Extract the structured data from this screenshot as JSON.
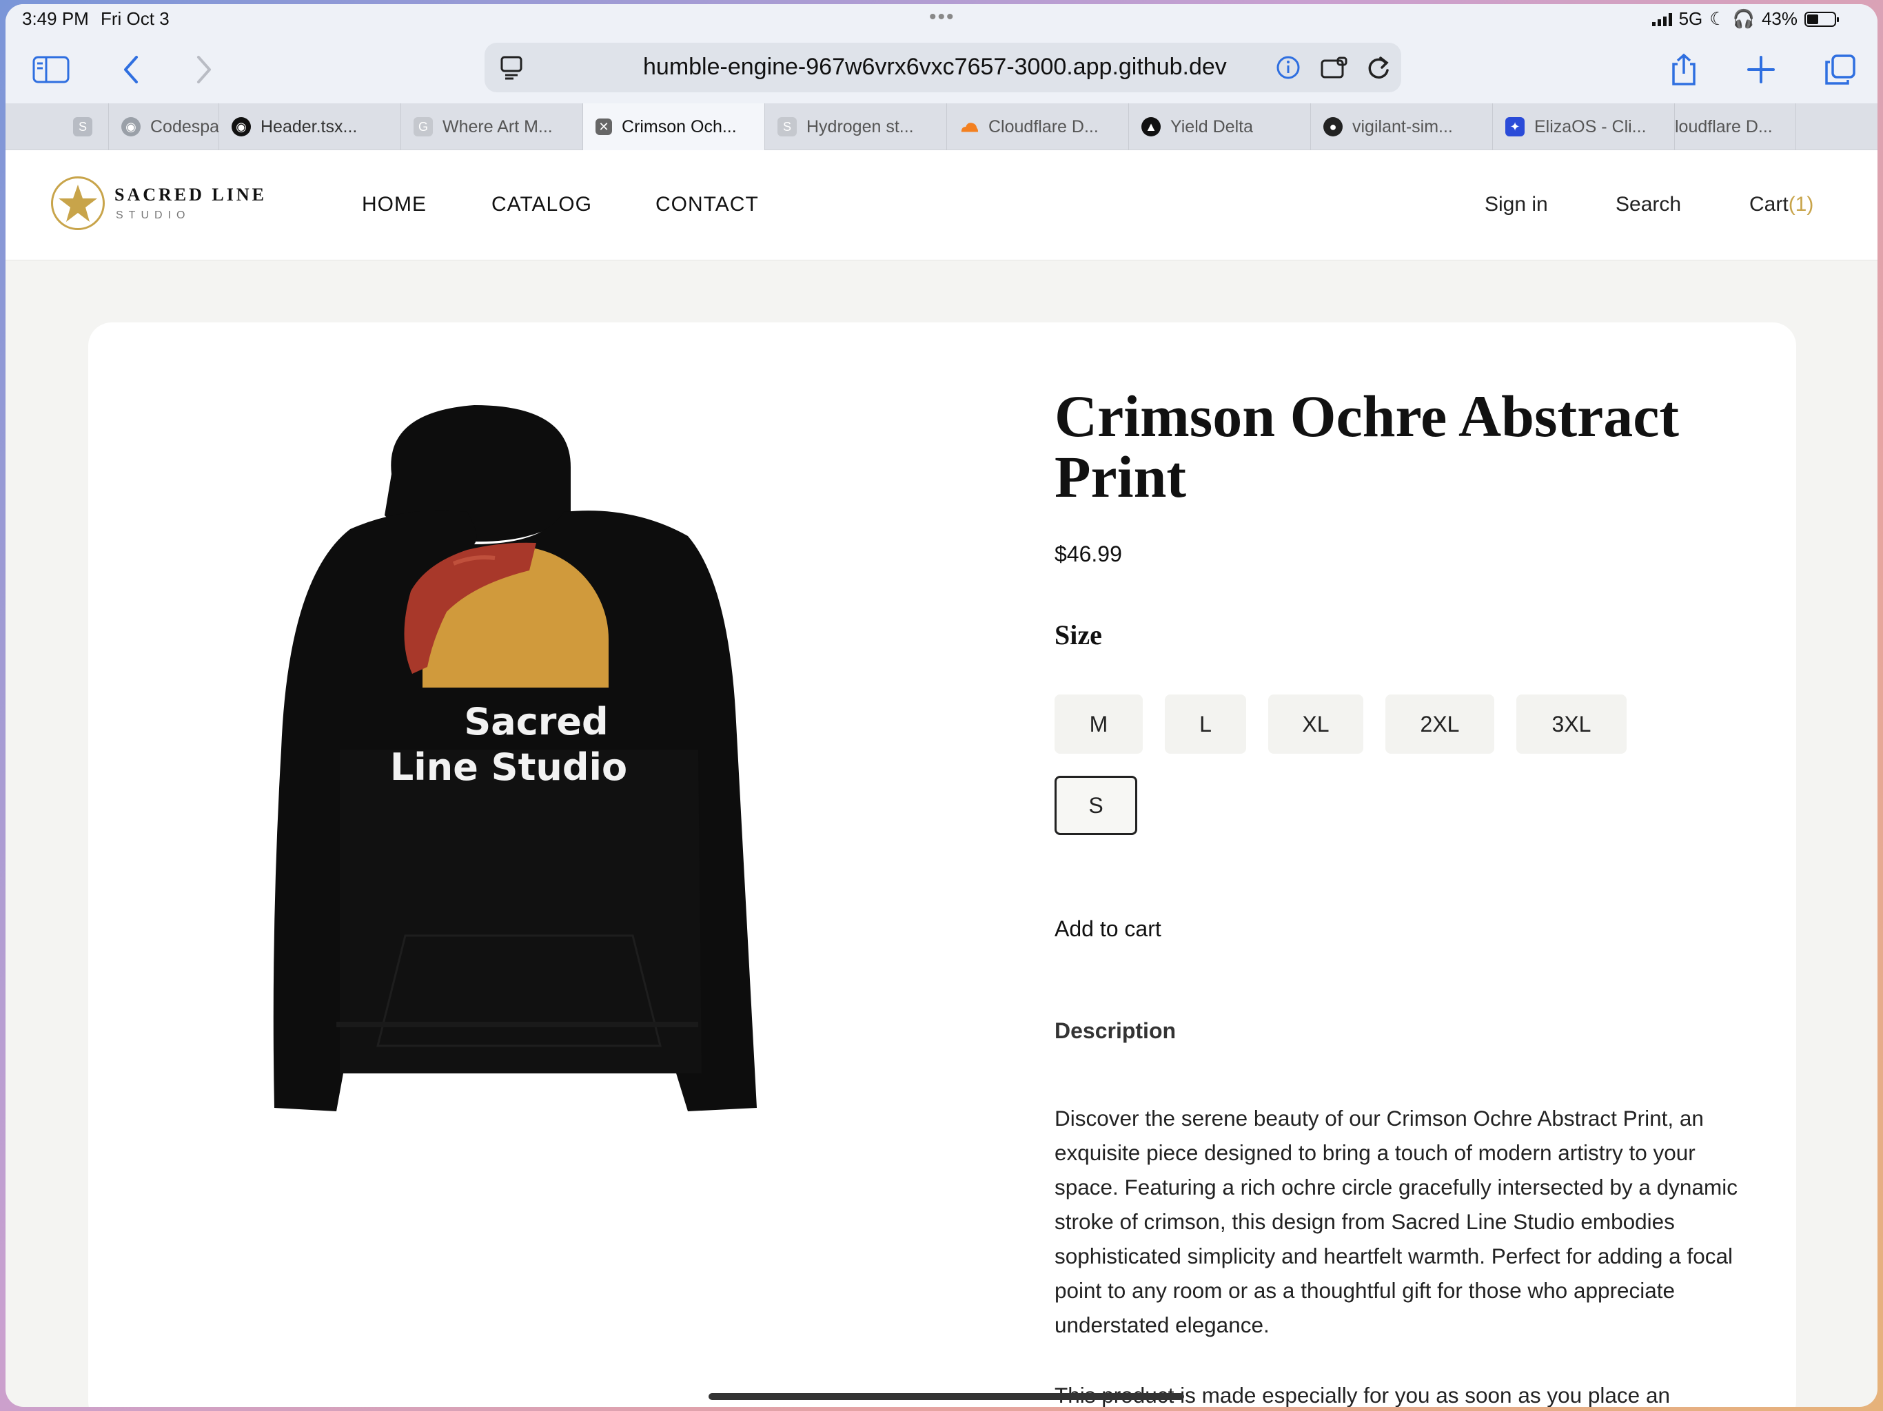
{
  "status_bar": {
    "time": "3:49 PM",
    "date": "Fri Oct 3",
    "network": "5G",
    "battery": "43%"
  },
  "browser": {
    "url": "humble-engine-967w6vrx6vxc7657-3000.app.github.dev",
    "tabs": [
      {
        "label": "S",
        "favicon": "S"
      },
      {
        "label": "Codespa",
        "favicon": "github"
      },
      {
        "label": "Header.tsx...",
        "favicon": "github"
      },
      {
        "label": "Where Art M...",
        "favicon": "G"
      },
      {
        "label": "Crimson Och...",
        "favicon": "close",
        "active": true
      },
      {
        "label": "Hydrogen st...",
        "favicon": "S"
      },
      {
        "label": "Cloudflare D...",
        "favicon": "cloudflare"
      },
      {
        "label": "Yield Delta",
        "favicon": "triangle"
      },
      {
        "label": "vigilant-sim...",
        "favicon": "dark-circle"
      },
      {
        "label": "ElizaOS - Cli...",
        "favicon": "eliza"
      },
      {
        "label": "loudflare D...",
        "favicon": ""
      }
    ]
  },
  "site": {
    "brand_name": "SACRED LINE",
    "brand_sub": "STUDIO",
    "nav": [
      "HOME",
      "CATALOG",
      "CONTACT"
    ],
    "sign_in": "Sign in",
    "search": "Search",
    "cart_label": "Cart",
    "cart_count": "(1)"
  },
  "product": {
    "title": "Crimson Ochre Abstract Print",
    "price": "$46.99",
    "size_label": "Size",
    "sizes": [
      "M",
      "L",
      "XL",
      "2XL",
      "3XL",
      "S"
    ],
    "selected_size": "S",
    "add_to_cart": "Add to cart",
    "description_label": "Description",
    "description": "Discover the serene beauty of our Crimson Ochre Abstract Print, an exquisite piece designed to bring a touch of modern artistry to your space. Featuring a rich ochre circle gracefully intersected by a dynamic stroke of crimson, this design from Sacred Line Studio embodies sophisticated simplicity and heartfelt warmth. Perfect for adding a focal point to any room or as a thoughtful gift for those who appreciate understated elegance.",
    "description_2": "This product is made especially for you as soon as you place an",
    "print_line1": "Sacred",
    "print_line2": "Line Studio"
  },
  "colors": {
    "accent_gold": "#c8a44a",
    "ochre": "#d09a3c",
    "crimson": "#a8382a",
    "hoodie": "#0d0d0d"
  }
}
